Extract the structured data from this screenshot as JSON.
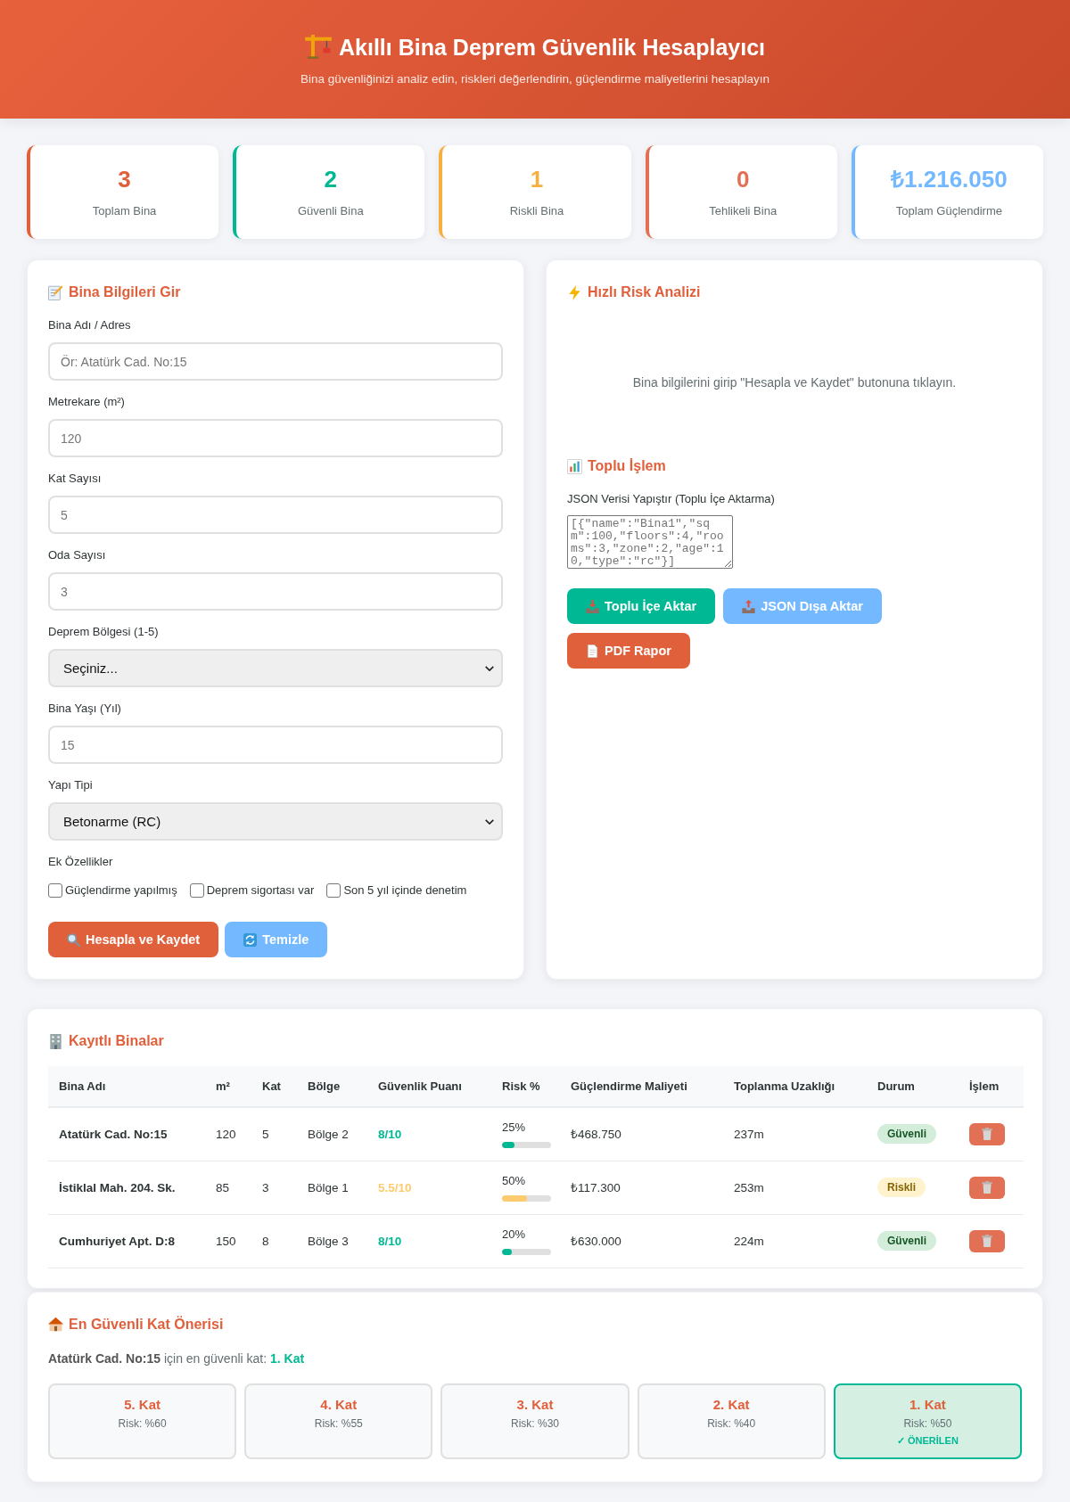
{
  "header": {
    "title": "Akıllı Bina Deprem Güvenlik Hesaplayıcı",
    "subtitle": "Bina güvenliğinizi analiz edin, riskleri değerlendirin, güçlendirme maliyetlerini hesaplayın"
  },
  "stats": [
    {
      "value": "3",
      "label": "Toplam Bina",
      "color": "#e1603c"
    },
    {
      "value": "2",
      "label": "Güvenli Bina",
      "color": "#00b894"
    },
    {
      "value": "1",
      "label": "Riskli Bina",
      "color": "#f5b041"
    },
    {
      "value": "0",
      "label": "Tehlikeli Bina",
      "color": "#e17055"
    },
    {
      "value": "₺1.216.050",
      "label": "Toplam Güçlendirme",
      "color": "#74b9ff"
    }
  ],
  "building_form": {
    "title": "Bina Bilgileri Gir",
    "fields": [
      {
        "kind": "input",
        "label": "Bina Adı / Adres",
        "placeholder": "Ör: Atatürk Cad. No:15"
      },
      {
        "kind": "input",
        "label": "Metrekare (m²)",
        "placeholder": "120"
      },
      {
        "kind": "input",
        "label": "Kat Sayısı",
        "placeholder": "5"
      },
      {
        "kind": "input",
        "label": "Oda Sayısı",
        "placeholder": "3"
      },
      {
        "kind": "select",
        "label": "Deprem Bölgesi (1-5)",
        "value": "Seçiniz..."
      },
      {
        "kind": "input",
        "label": "Bina Yaşı (Yıl)",
        "placeholder": "15"
      },
      {
        "kind": "select",
        "label": "Yapı Tipi",
        "value": "Betonarme (RC)"
      }
    ],
    "extras": {
      "label": "Ek Özellikler",
      "options": [
        {
          "label": "Güçlendirme yapılmış",
          "checked": false
        },
        {
          "label": "Deprem sigortası var",
          "checked": false
        },
        {
          "label": "Son 5 yıl içinde denetim",
          "checked": false
        }
      ]
    },
    "buttons": [
      {
        "kind": "calculate",
        "label": "Hesapla ve Kaydet"
      },
      {
        "kind": "clear",
        "label": "Temizle"
      }
    ]
  },
  "quick_analysis": {
    "title": "Hızlı Risk Analizi",
    "message": "Bina bilgilerini girip \"Hesapla ve Kaydet\" butonuna tıklayın."
  },
  "bulk": {
    "title": "Toplu İşlem",
    "label": "JSON Verisi Yapıştır (Toplu İçe Aktarma)",
    "placeholder": "[{\"name\":\"Bina1\",\"sqm\":100,\"floors\":4,\"rooms\":3,\"zone\":2,\"age\":10,\"type\":\"rc\"}]",
    "buttons": [
      {
        "kind": "import",
        "label": "Toplu İçe Aktar"
      },
      {
        "kind": "export",
        "label": "JSON Dışa Aktar"
      },
      {
        "kind": "pdf",
        "label": "PDF Rapor"
      }
    ]
  },
  "buildings": {
    "title": "Kayıtlı Binalar",
    "columns": [
      "Bina Adı",
      "m²",
      "Kat",
      "Bölge",
      "Güvenlik Puanı",
      "Risk %",
      "Güçlendirme Maliyeti",
      "Toplanma Uzaklığı",
      "Durum",
      "İşlem"
    ],
    "rows": [
      {
        "name": "Atatürk Cad. No:15",
        "sqm": "120",
        "floors": "5",
        "zone": "Bölge 2",
        "score": "8/10",
        "risk": {
          "reading": "25%",
          "level": 0.25
        },
        "cost": "₺468.750",
        "distance": "237m",
        "status": {
          "label": "Güvenli",
          "kind": "safe"
        }
      },
      {
        "name": "İstiklal Mah. 204. Sk.",
        "sqm": "85",
        "floors": "3",
        "zone": "Bölge 1",
        "score": "5.5/10",
        "risk": {
          "reading": "50%",
          "level": 0.5
        },
        "cost": "₺117.300",
        "distance": "253m",
        "status": {
          "label": "Riskli",
          "kind": "risky"
        }
      },
      {
        "name": "Cumhuriyet Apt. D:8",
        "sqm": "150",
        "floors": "8",
        "zone": "Bölge 3",
        "score": "8/10",
        "risk": {
          "reading": "20%",
          "level": 0.2
        },
        "cost": "₺630.000",
        "distance": "224m",
        "status": {
          "label": "Güvenli",
          "kind": "safe"
        }
      }
    ]
  },
  "floor_advice": {
    "title": "En Güvenli Kat Önerisi",
    "summary": "**Atatürk Cad. No:15** için en güvenli kat: **1. Kat**",
    "floors": [
      {
        "label": "5. Kat",
        "risk": "Risk: %60",
        "recommended": false
      },
      {
        "label": "4. Kat",
        "risk": "Risk: %55",
        "recommended": false
      },
      {
        "label": "3. Kat",
        "risk": "Risk: %30",
        "recommended": false
      },
      {
        "label": "2. Kat",
        "risk": "Risk: %40",
        "recommended": false
      },
      {
        "label": "1. Kat",
        "risk": "Risk: %50",
        "recommended": true,
        "badge": "✓ ÖNERİLEN"
      }
    ]
  }
}
